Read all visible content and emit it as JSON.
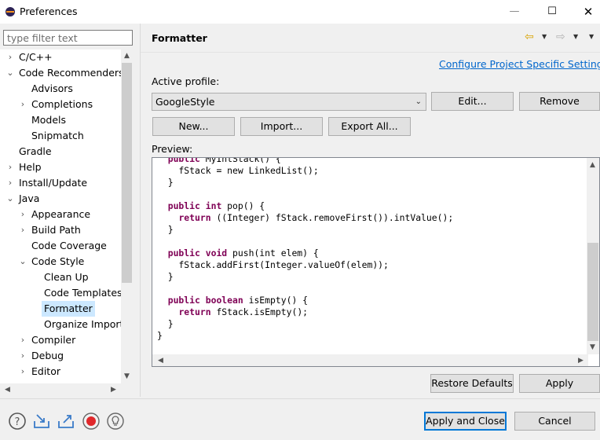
{
  "window": {
    "title": "Preferences",
    "minimize": "—",
    "maximize": "☐",
    "close": "✕"
  },
  "filter": {
    "placeholder": "type filter text"
  },
  "tree": [
    {
      "label": "C/C++",
      "twisty": "›",
      "indent": 0
    },
    {
      "label": "Code Recommenders",
      "twisty": "⌄",
      "indent": 0
    },
    {
      "label": "Advisors",
      "twisty": "",
      "indent": 1
    },
    {
      "label": "Completions",
      "twisty": "›",
      "indent": 1
    },
    {
      "label": "Models",
      "twisty": "",
      "indent": 1
    },
    {
      "label": "Snipmatch",
      "twisty": "",
      "indent": 1
    },
    {
      "label": "Gradle",
      "twisty": "",
      "indent": 0
    },
    {
      "label": "Help",
      "twisty": "›",
      "indent": 0
    },
    {
      "label": "Install/Update",
      "twisty": "›",
      "indent": 0
    },
    {
      "label": "Java",
      "twisty": "⌄",
      "indent": 0
    },
    {
      "label": "Appearance",
      "twisty": "›",
      "indent": 1
    },
    {
      "label": "Build Path",
      "twisty": "›",
      "indent": 1
    },
    {
      "label": "Code Coverage",
      "twisty": "",
      "indent": 1
    },
    {
      "label": "Code Style",
      "twisty": "⌄",
      "indent": 1
    },
    {
      "label": "Clean Up",
      "twisty": "",
      "indent": 2
    },
    {
      "label": "Code Templates",
      "twisty": "",
      "indent": 2
    },
    {
      "label": "Formatter",
      "twisty": "",
      "indent": 2,
      "selected": true
    },
    {
      "label": "Organize Imports",
      "twisty": "",
      "indent": 2
    },
    {
      "label": "Compiler",
      "twisty": "›",
      "indent": 1
    },
    {
      "label": "Debug",
      "twisty": "›",
      "indent": 1
    },
    {
      "label": "Editor",
      "twisty": "›",
      "indent": 1
    }
  ],
  "page": {
    "title": "Formatter",
    "configure_link": "Configure Project Specific Settings...",
    "active_profile_label": "Active profile:",
    "profile_value": "GoogleStyle",
    "edit_label": "Edit...",
    "remove_label": "Remove",
    "new_label": "New...",
    "import_label": "Import...",
    "export_label": "Export All...",
    "preview_label": "Preview:",
    "code": [
      {
        "indent": "  ",
        "kw": "public",
        "rest": " MyIntStack() {"
      },
      {
        "indent": "    ",
        "kw": "",
        "rest": "fStack = new LinkedList();"
      },
      {
        "indent": "  ",
        "kw": "",
        "rest": "}"
      },
      {
        "indent": "",
        "kw": "",
        "rest": ""
      },
      {
        "indent": "  ",
        "kw": "public int",
        "rest": " pop() {"
      },
      {
        "indent": "    ",
        "kw": "return",
        "rest": " ((Integer) fStack.removeFirst()).intValue();"
      },
      {
        "indent": "  ",
        "kw": "",
        "rest": "}"
      },
      {
        "indent": "",
        "kw": "",
        "rest": ""
      },
      {
        "indent": "  ",
        "kw": "public void",
        "rest": " push(int elem) {"
      },
      {
        "indent": "    ",
        "kw": "",
        "rest": "fStack.addFirst(Integer.valueOf(elem));"
      },
      {
        "indent": "  ",
        "kw": "",
        "rest": "}"
      },
      {
        "indent": "",
        "kw": "",
        "rest": ""
      },
      {
        "indent": "  ",
        "kw": "public boolean",
        "rest": " isEmpty() {"
      },
      {
        "indent": "    ",
        "kw": "return",
        "rest": " fStack.isEmpty();"
      },
      {
        "indent": "  ",
        "kw": "",
        "rest": "}"
      },
      {
        "indent": "",
        "kw": "",
        "rest": "}"
      }
    ],
    "restore_label": "Restore Defaults",
    "apply_label": "Apply"
  },
  "footer": {
    "apply_close_label": "Apply and Close",
    "cancel_label": "Cancel"
  },
  "colors": {
    "keyword": "#7f0055",
    "link": "#0066cc",
    "selection": "#cce8ff",
    "default_button_border": "#0078d7"
  }
}
